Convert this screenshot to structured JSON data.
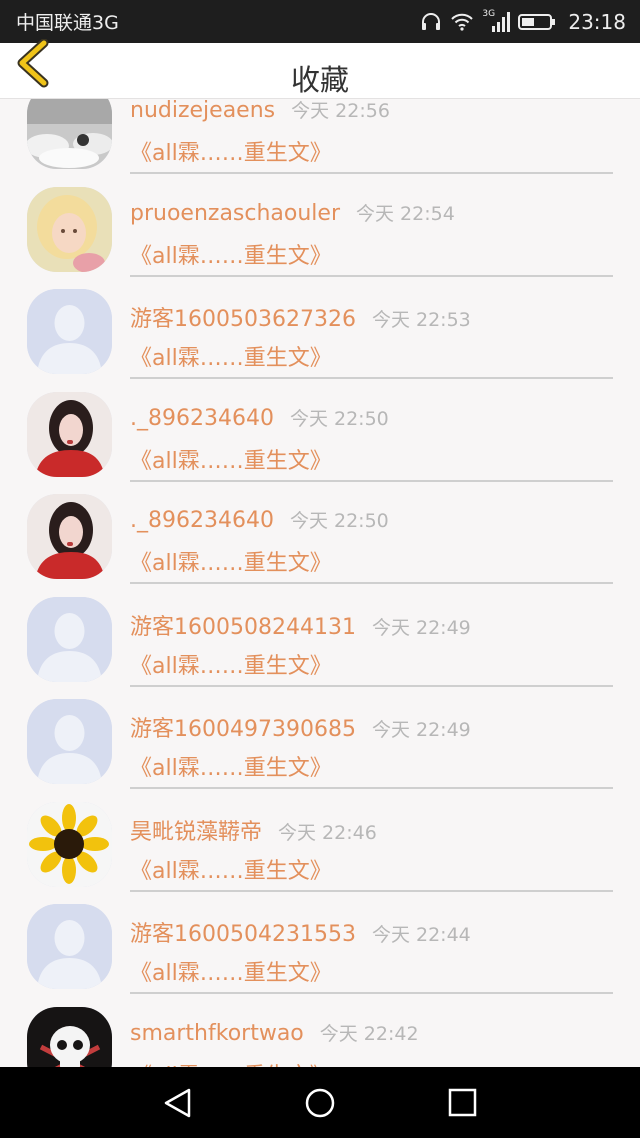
{
  "status_bar": {
    "carrier": "中国联通3G",
    "network_label": "3G",
    "time": "23:18"
  },
  "header": {
    "title": "收藏",
    "back_icon": "chevron-left-icon",
    "accent_color": "#f0c419"
  },
  "items": [
    {
      "name": "nudizejeaens",
      "time": "今天 22:56",
      "book": "《all霖……重生文》",
      "avatar": "clouds"
    },
    {
      "name": "pruoenzaschaouler",
      "time": "今天 22:54",
      "book": "《all霖……重生文》",
      "avatar": "child"
    },
    {
      "name": "游客1600503627326",
      "time": "今天 22:53",
      "book": "《all霖……重生文》",
      "avatar": "default"
    },
    {
      "name": "._896234640",
      "time": "今天 22:50",
      "book": "《all霖……重生文》",
      "avatar": "girl"
    },
    {
      "name": "._896234640",
      "time": "今天 22:50",
      "book": "《all霖……重生文》",
      "avatar": "girl"
    },
    {
      "name": "游客1600508244131",
      "time": "今天 22:49",
      "book": "《all霖……重生文》",
      "avatar": "default"
    },
    {
      "name": "游客1600497390685",
      "time": "今天 22:49",
      "book": "《all霖……重生文》",
      "avatar": "default"
    },
    {
      "name": "昊毗锐藻鞯帝",
      "time": "今天 22:46",
      "book": "《all霖……重生文》",
      "avatar": "sunflower"
    },
    {
      "name": "游客1600504231553",
      "time": "今天 22:44",
      "book": "《all霖……重生文》",
      "avatar": "default"
    },
    {
      "name": "smarthfkortwao",
      "time": "今天 22:42",
      "book": "《all霖……重生文》",
      "avatar": "skull"
    }
  ],
  "colors": {
    "name_text": "#e3905c",
    "time_text": "#b7b7b7",
    "background": "#f8f6f6"
  },
  "nav_bar": {
    "back_icon": "triangle-back-icon",
    "home_icon": "circle-home-icon",
    "recents_icon": "square-recents-icon"
  }
}
